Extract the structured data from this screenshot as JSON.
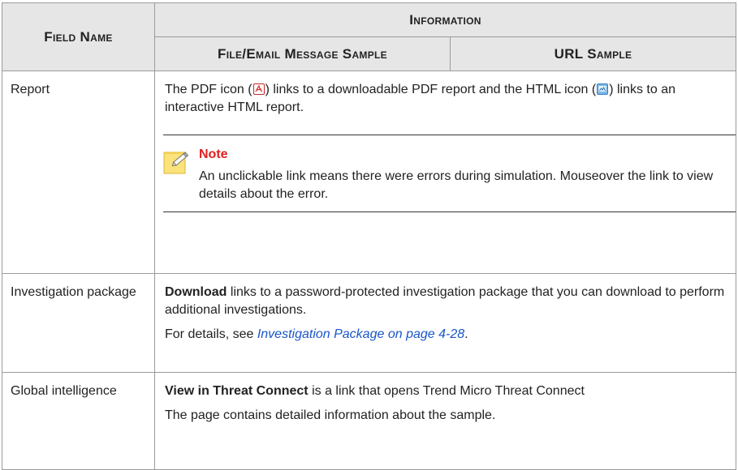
{
  "header": {
    "field_name": "Field Name",
    "information": "Information",
    "file_email_sample": "File/Email Message Sample",
    "url_sample": "URL Sample"
  },
  "rows": [
    {
      "field": "Report",
      "text_a": "The PDF icon (",
      "text_b": ") links to a downloadable PDF report and the HTML icon (",
      "text_c": ") links to an interactive HTML report.",
      "note_title": "Note",
      "note_body": "An unclickable link means there were errors during simulation. Mouseover the link to view details about the error."
    },
    {
      "field": "Investigation package",
      "bold": "Download",
      "text": " links to a password-protected investigation package that you can download to perform additional investigations.",
      "details_prefix": "For details, see ",
      "link": "Investigation Package on page 4-28",
      "details_suffix": "."
    },
    {
      "field": "Global intelligence",
      "bold": "View in Threat Connect",
      "text": " is a link that opens Trend Micro Threat Connect",
      "text2": "The page contains detailed information about the sample."
    }
  ],
  "icons": {
    "pdf": "pdf-icon",
    "html": "html-report-icon",
    "note": "note-pencil-icon"
  },
  "colors": {
    "header_bg": "#e6e6e6",
    "note_title": "#e02020",
    "link": "#1a56c8"
  }
}
